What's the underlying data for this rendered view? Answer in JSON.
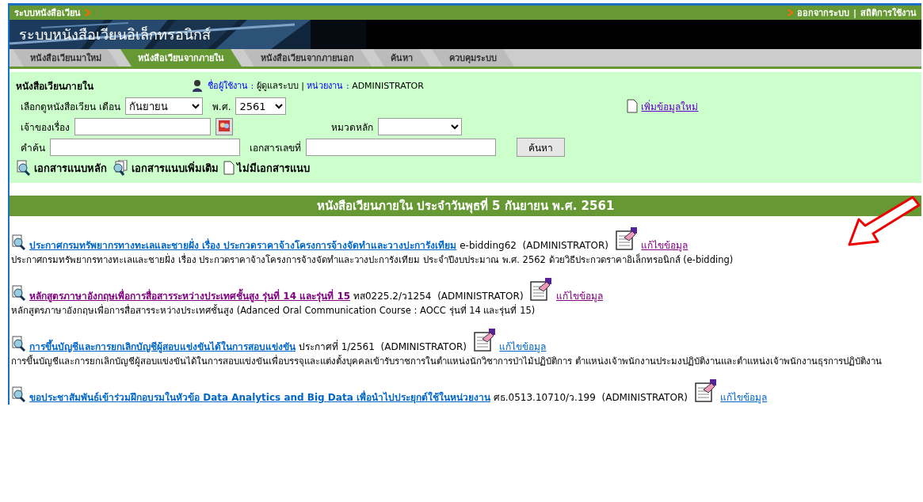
{
  "breadcrumb": "ระบบหนังสือเวียน",
  "top_links": [
    {
      "label": "ออกจากระบบ"
    },
    {
      "label": "สถิติการใช้งาน"
    }
  ],
  "top_separator": "|",
  "app_title": "ระบบหนังสือเวียนอิเล็กทรอนิกส์",
  "tabs": [
    {
      "label": "หนังสือเวียนมาใหม่",
      "selected": false
    },
    {
      "label": "หนังสือเวียนจากภายใน",
      "selected": true
    },
    {
      "label": "หนังสือเวียนจากภายนอก",
      "selected": false
    },
    {
      "label": "ค้นหา",
      "selected": false
    },
    {
      "label": "ควบคุมระบบ",
      "selected": false
    }
  ],
  "filter": {
    "heading": "หนังสือเวียนภายใน",
    "user_label": "ชื่อผู้ใช้งาน :",
    "user_value": "ผู้ดูแลระบบ",
    "divider": "|",
    "unit_label": "หน่วยงาน :",
    "unit_value": "ADMINISTRATOR",
    "month_label": "เลือกดูหนังสือเวียน เดือน",
    "month_value": "กันยายน",
    "year_label": "พ.ศ.",
    "year_value": "2561",
    "add_link": "เพิ่มข้อมูลใหม่",
    "owner_label": "เจ้าของเรื่อง",
    "category_label": "หมวดหลัก",
    "keyword_label": "คำค้น",
    "docno_label": "เอกสารเลขที่",
    "search_button": "ค้นหา"
  },
  "legend": [
    {
      "kind": "main",
      "label": "เอกสารแนบหลัก"
    },
    {
      "kind": "extra",
      "label": "เอกสารแนบเพิ่มเติม"
    },
    {
      "kind": "none",
      "label": "ไม่มีเอกสารแนบ"
    }
  ],
  "list_heading": "หนังสือเวียนภายใน ประจำวันพุธที่ 5 กันยายน พ.ศ. 2561",
  "items": [
    {
      "title": "ประกาศกรมทรัพยากรทางทะเลและชายฝั่ง เรื่อง ประกวดราคาจ้างโครงการจ้างจัดทำและวางปะการังเทียม",
      "title_visited": false,
      "ref": "e-bidding62",
      "owner": "(ADMINISTRATOR)",
      "edit": "แก้ไขข้อมูล",
      "edit_visited": true,
      "description": "ประกาศกรมทรัพยากรทางทะเลและชายฝั่ง เรื่อง ประกวดราคาจ้างโครงการจ้างจัดทำและวางปะการังเทียม ประจำปีงบประมาณ พ.ศ. 2562 ด้วยวิธีประกวดราคาอิเล็กทรอนิกส์ (e-bidding)"
    },
    {
      "title": "หลักสูตรภาษาอังกฤษเพื่อการสื่อสารระหว่างประเทศชั้นสูง รุ่นที่ 14 และรุ่นที่ 15",
      "title_visited": true,
      "ref": "ทส0225.2/ว1254",
      "owner": "(ADMINISTRATOR)",
      "edit": "แก้ไขข้อมูล",
      "edit_visited": true,
      "description": "หลักสูตรภาษาอังกฤษเพื่อการสื่อสารระหว่างประเทศชั้นสูง (Adanced Oral Communication Course : AOCC รุ่นที่ 14 และรุ่นที่ 15)"
    },
    {
      "title": "การขึ้นบัญชีและการยกเลิกบัญชีผู้สอบแข่งขันได้ในการสอบแข่งขัน",
      "title_visited": false,
      "ref": "ประกาศที่ 1/2561",
      "owner": "(ADMINISTRATOR)",
      "edit": "แก้ไขข้อมูล",
      "edit_visited": false,
      "description": "การขึ้นบัญชีและการยกเลิกบัญชีผู้สอบแข่งขันได้ในการสอบแข่งขันเพื่อบรรจุและแต่งตั้งบุคคลเข้ารับราชการในตำแหน่งนักวิชาการป่าไม้ปฏิบัติการ ตำแหน่งเจ้าพนักงานประมงปฏิบัติงานและตำแหน่งเจ้าพนักงานธุรการปฏิบัติงาน"
    },
    {
      "title": "ขอประชาสัมพันธ์เข้าร่วมฝึกอบรมในหัวข้อ Data Analytics and Big Data เพื่อนำไปประยุกต์ใช้ในหน่วยงาน",
      "title_visited": false,
      "ref": "ศธ.0513.10710/ว.199",
      "owner": "(ADMINISTRATOR)",
      "edit": "แก้ไขข้อมูล",
      "edit_visited": false
    }
  ],
  "callout_arrow": true
}
